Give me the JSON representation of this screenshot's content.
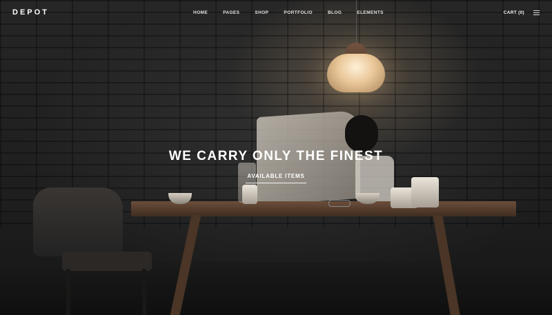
{
  "header": {
    "logo": "DEPOT",
    "nav": [
      {
        "label": "HOME"
      },
      {
        "label": "PAGES"
      },
      {
        "label": "SHOP"
      },
      {
        "label": "PORTFOLIO"
      },
      {
        "label": "BLOG"
      },
      {
        "label": "ELEMENTS"
      }
    ],
    "cart_label": "CART (0)",
    "menu_icon": "hamburger-menu-icon"
  },
  "hero": {
    "title": "WE CARRY ONLY THE FINEST",
    "subtitle": "AVAILABLE ITEMS"
  }
}
